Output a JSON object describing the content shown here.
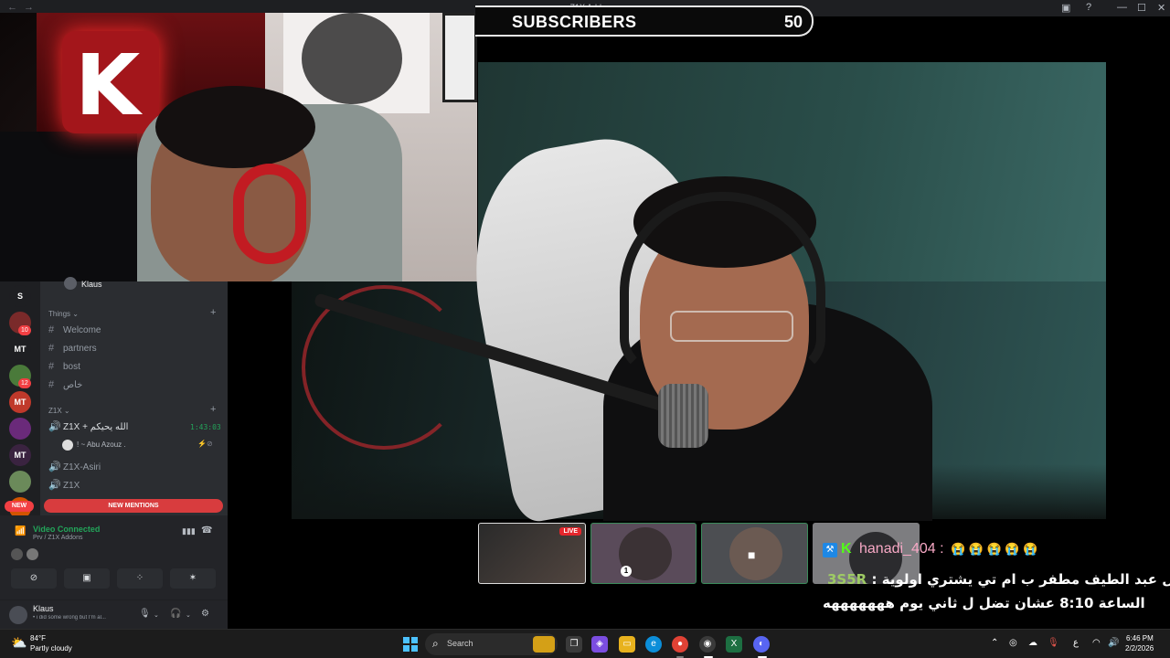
{
  "window": {
    "title": "Z1X Addons",
    "back": "←",
    "forward": "→",
    "controls": {
      "inbox": "▣",
      "help": "?",
      "minimize": "—",
      "maximize": "☐",
      "close": "✕"
    }
  },
  "overlay": {
    "subscribers_label": "SUBSCRIBERS",
    "subscribers_count": "50"
  },
  "discord": {
    "server_rail": [
      {
        "label": "S",
        "color": "#1e1f22"
      },
      {
        "label": "",
        "color": "#7a2a2a",
        "badge": "10"
      },
      {
        "label": "MT",
        "color": "#1e1f22"
      },
      {
        "label": "",
        "color": "#4a7a3a",
        "badge": "12"
      },
      {
        "label": "MT",
        "color": "#c0392b"
      },
      {
        "label": "",
        "color": "#6a2a7a"
      },
      {
        "label": "MT",
        "color": "#3a2340"
      },
      {
        "label": "",
        "color": "#6b8a5a"
      },
      {
        "label": "MT",
        "color": "#d35400"
      }
    ],
    "server_header": "Klaus",
    "categories": [
      {
        "name": "Things",
        "plus": "+"
      },
      {
        "name": "Z1X",
        "plus": "+"
      }
    ],
    "text_channels": [
      "Welcome",
      "partners",
      "bost",
      "خاص"
    ],
    "voice_channels": [
      {
        "name": "Z1X + الله يحيكم",
        "time": "1:43:03"
      },
      {
        "name": "Z1X-Asiri"
      },
      {
        "name": "Z1X"
      }
    ],
    "voice_user": {
      "name": "! ~ Abu Azouz .",
      "icons": "⚡⊘"
    },
    "new_pill": "NEW",
    "new_mentions": "NEW MENTIONS",
    "video_connected": {
      "title": "Video Connected",
      "subtitle": "Prv / Z1X Addons",
      "buttons": [
        "⊘",
        "▣",
        "⁘",
        "✶"
      ]
    },
    "user": {
      "name": "Klaus",
      "status": "• i did some wrong but I'm al..."
    }
  },
  "chat": {
    "username": "hanadi_404",
    "emojis": "😭 😭 😭 😭 😭",
    "line2_user": "3S5R",
    "line2_text": "يا رجال عبد الطيف مطفر ب ام تي يشتري اولوية :",
    "line3_text": "الساعة 8:10 عشان تضل ل ثاني يوم هههههههه"
  },
  "thumbnails": {
    "live_label": "LIVE",
    "badge_number": "1"
  },
  "taskbar": {
    "weather_temp": "84°F",
    "weather_desc": "Partly cloudy",
    "search_label": "Search",
    "tray_lang": "ع",
    "clock_time": "6:46 PM",
    "clock_date": "2/2/2026"
  },
  "colors": {
    "discord_bg": "#2b2d31",
    "discord_green": "#23a55a",
    "discord_red": "#f23f43",
    "kick_green": "#53fc18"
  }
}
